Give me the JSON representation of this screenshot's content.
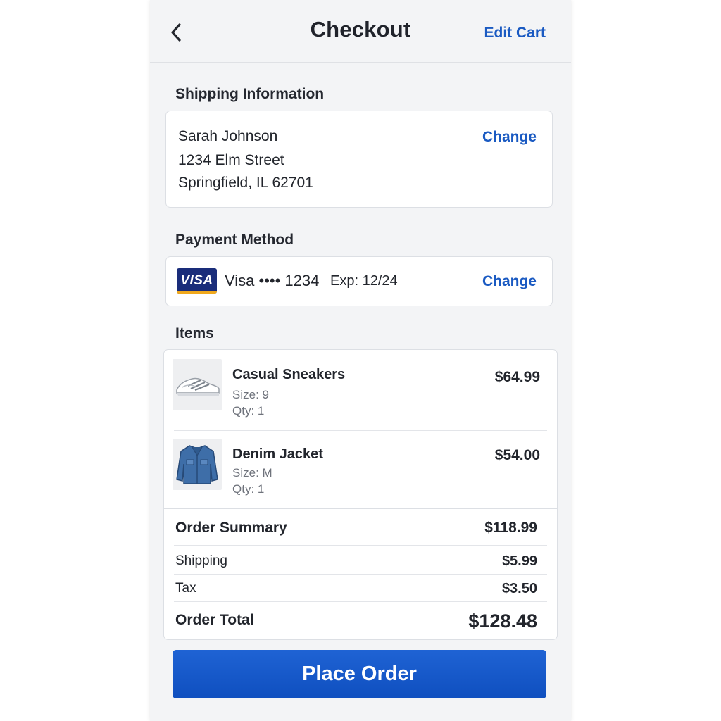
{
  "header": {
    "title": "Checkout",
    "back_icon": "chevron-left-icon",
    "edit_cart_label": "Edit Cart"
  },
  "shipping": {
    "title": "Shipping Information",
    "name": "Sarah Johnson",
    "street": "1234 Elm Street",
    "city_state_zip": "Springfield, IL 62701",
    "change_label": "Change"
  },
  "payment": {
    "title": "Payment Method",
    "brand_logo": "VISA",
    "card_label": "Visa •••• 1234",
    "expiry": "Exp: 12/24",
    "change_label": "Change"
  },
  "items": {
    "title": "Items",
    "list": [
      {
        "name": "Casual Sneakers",
        "size": "Size: 9",
        "qty": "Qty: 1",
        "price": "$64.99",
        "icon": "sneaker-image"
      },
      {
        "name": "Denim Jacket",
        "size": "Size: M",
        "qty": "Qty: 1",
        "price": "$54.00",
        "icon": "denim-jacket-image"
      }
    ]
  },
  "summary": {
    "label": "Order Summary",
    "subtotal": "$118.99",
    "shipping_label": "Shipping",
    "shipping": "$5.99",
    "tax_label": "Tax",
    "tax": "$3.50",
    "total_label": "Order Total",
    "total": "$128.48"
  },
  "actions": {
    "place_order_label": "Place Order"
  },
  "colors": {
    "accent": "#1a5ac2",
    "button": "#1257c8",
    "background": "#f3f4f6"
  }
}
